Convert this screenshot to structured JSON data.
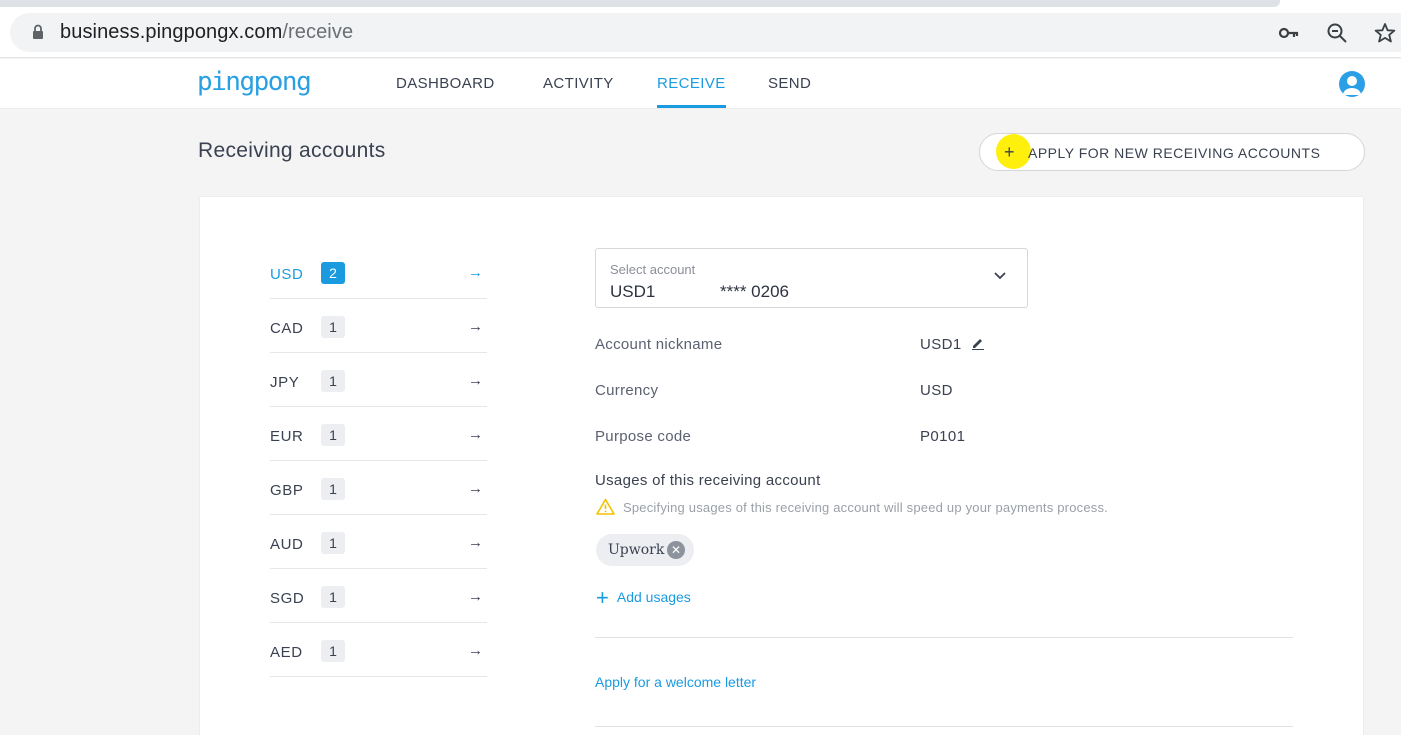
{
  "browser": {
    "url_host": "business.pingpongx.com",
    "url_path": "/receive"
  },
  "app": {
    "logo": "pingpong",
    "nav": [
      "DASHBOARD",
      "ACTIVITY",
      "RECEIVE",
      "SEND"
    ],
    "active_nav": "RECEIVE"
  },
  "page": {
    "title": "Receiving accounts",
    "apply_button": "APPLY FOR NEW RECEIVING ACCOUNTS"
  },
  "currencies": [
    {
      "code": "USD",
      "count": "2",
      "active": true
    },
    {
      "code": "CAD",
      "count": "1"
    },
    {
      "code": "JPY",
      "count": "1"
    },
    {
      "code": "EUR",
      "count": "1"
    },
    {
      "code": "GBP",
      "count": "1"
    },
    {
      "code": "AUD",
      "count": "1"
    },
    {
      "code": "SGD",
      "count": "1"
    },
    {
      "code": "AED",
      "count": "1"
    }
  ],
  "account": {
    "select_label": "Select account",
    "selected_name": "USD1",
    "selected_mask": "**** 0206",
    "fields": [
      {
        "label": "Account nickname",
        "value": "USD1"
      },
      {
        "label": "Currency",
        "value": "USD"
      },
      {
        "label": "Purpose code",
        "value": "P0101"
      }
    ],
    "usages_title": "Usages of this receiving account",
    "usages_hint": "Specifying usages of this receiving account will speed up your payments process.",
    "usage_chips": [
      "Upwork"
    ],
    "add_usages": "Add usages",
    "welcome_letter": "Apply for a welcome letter"
  },
  "colors": {
    "accent": "#1a9be0",
    "warning": "#f2c200",
    "cursor_highlight": "#ffee00"
  }
}
